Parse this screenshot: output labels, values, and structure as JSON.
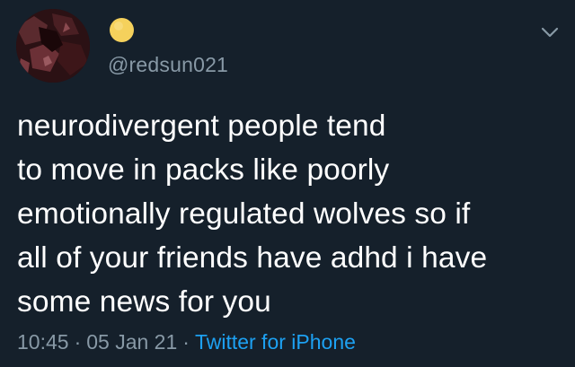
{
  "tweet": {
    "handle": "@redsun021",
    "display_name_emoji": "yellow-circle-emoji",
    "text": "neurodivergent people tend\nto move in packs like poorly\nemotionally regulated wolves so if\nall of your friends have adhd i have\nsome news for you",
    "time": "10:45",
    "date": "05 Jan 21",
    "separator": "·",
    "source": "Twitter for iPhone"
  },
  "icons": {
    "caret": "chevron-down-icon",
    "avatar": "avatar-image"
  },
  "colors": {
    "background": "#15202b",
    "text": "#ffffff",
    "secondary_text": "#8899a6",
    "link": "#1da1f2",
    "emoji": "#f5d15c"
  }
}
